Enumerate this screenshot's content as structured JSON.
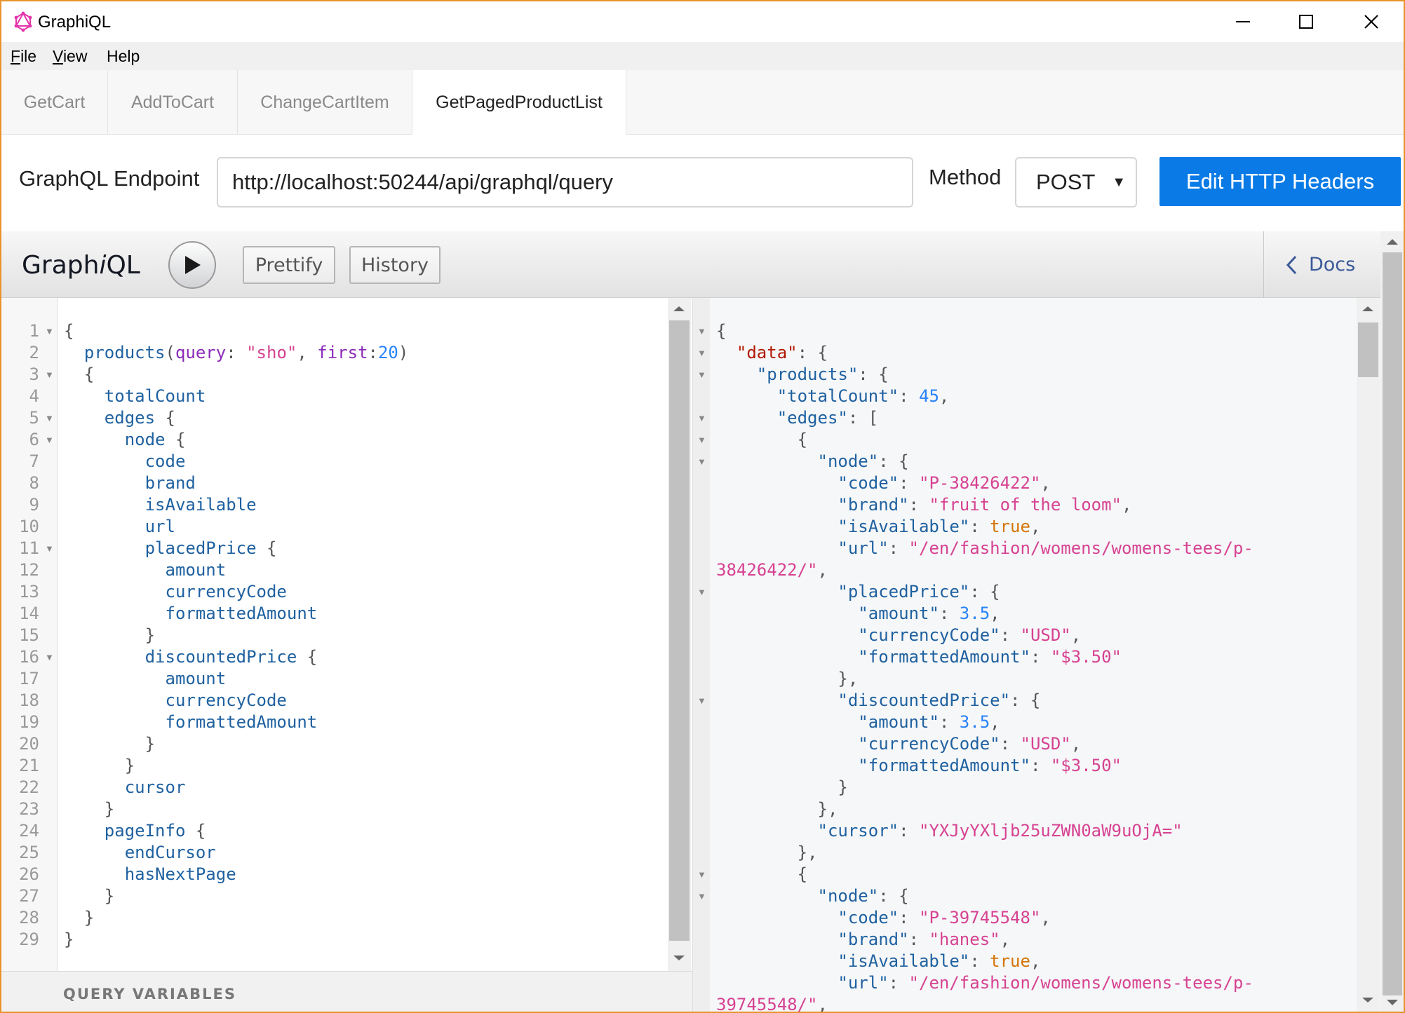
{
  "window": {
    "title": "GraphiQL",
    "accent_color": "#e8932b"
  },
  "menu": [
    {
      "label": "File",
      "mnemonic": "F",
      "rest": "ile"
    },
    {
      "label": "View",
      "mnemonic": "V",
      "rest": "iew"
    },
    {
      "label": "Help",
      "mnemonic": "",
      "rest": "Help"
    }
  ],
  "tabs": [
    {
      "label": "GetCart",
      "active": false
    },
    {
      "label": "AddToCart",
      "active": false
    },
    {
      "label": "ChangeCartItem",
      "active": false
    },
    {
      "label": "GetPagedProductList",
      "active": true
    }
  ],
  "endpoint": {
    "label": "GraphQL Endpoint",
    "value": "http://localhost:50244/api/graphql/query",
    "method_label": "Method",
    "method_value": "POST",
    "edit_headers_label": "Edit HTTP Headers",
    "button_color": "#0a7be6"
  },
  "graphiql": {
    "logo_pre": "Graph",
    "logo_i": "i",
    "logo_post": "QL",
    "prettify_label": "Prettify",
    "history_label": "History",
    "docs_label": "Docs",
    "query_variables_label": "QUERY VARIABLES"
  },
  "query_lines": [
    [
      [
        "p",
        "{"
      ]
    ],
    [
      [
        "d",
        "  products"
      ],
      [
        "p",
        "("
      ],
      [
        "a",
        "query"
      ],
      [
        "p",
        ": "
      ],
      [
        "s",
        "\"sho\""
      ],
      [
        "p",
        ", "
      ],
      [
        "a",
        "first"
      ],
      [
        "p",
        ":"
      ],
      [
        "n",
        "20"
      ],
      [
        "p",
        ")"
      ]
    ],
    [
      [
        "p",
        "  {"
      ]
    ],
    [
      [
        "d",
        "    totalCount"
      ]
    ],
    [
      [
        "d",
        "    edges"
      ],
      [
        "p",
        " {"
      ]
    ],
    [
      [
        "d",
        "      node"
      ],
      [
        "p",
        " {"
      ]
    ],
    [
      [
        "d",
        "        code"
      ]
    ],
    [
      [
        "d",
        "        brand"
      ]
    ],
    [
      [
        "d",
        "        isAvailable"
      ]
    ],
    [
      [
        "d",
        "        url"
      ]
    ],
    [
      [
        "d",
        "        placedPrice"
      ],
      [
        "p",
        " {"
      ]
    ],
    [
      [
        "d",
        "          amount"
      ]
    ],
    [
      [
        "d",
        "          currencyCode"
      ]
    ],
    [
      [
        "d",
        "          formattedAmount"
      ]
    ],
    [
      [
        "p",
        "        }"
      ]
    ],
    [
      [
        "d",
        "        discountedPrice"
      ],
      [
        "p",
        " {"
      ]
    ],
    [
      [
        "d",
        "          amount"
      ]
    ],
    [
      [
        "d",
        "          currencyCode"
      ]
    ],
    [
      [
        "d",
        "          formattedAmount"
      ]
    ],
    [
      [
        "p",
        "        }"
      ]
    ],
    [
      [
        "p",
        "      }"
      ]
    ],
    [
      [
        "d",
        "      cursor"
      ]
    ],
    [
      [
        "p",
        "    }"
      ]
    ],
    [
      [
        "d",
        "    pageInfo"
      ],
      [
        "p",
        " {"
      ]
    ],
    [
      [
        "d",
        "      endCursor"
      ]
    ],
    [
      [
        "d",
        "      hasNextPage"
      ]
    ],
    [
      [
        "p",
        "    }"
      ]
    ],
    [
      [
        "p",
        "  }"
      ]
    ],
    [
      [
        "p",
        "}"
      ]
    ]
  ],
  "query_fold_lines": [
    1,
    3,
    5,
    6,
    11,
    16
  ],
  "result_lines": [
    [
      [
        "p",
        "{"
      ]
    ],
    [
      [
        "p",
        "  "
      ],
      [
        "k",
        "\"data\""
      ],
      [
        "p",
        ": {"
      ]
    ],
    [
      [
        "p",
        "    "
      ],
      [
        "k2",
        "\"products\""
      ],
      [
        "p",
        ": {"
      ]
    ],
    [
      [
        "p",
        "      "
      ],
      [
        "k2",
        "\"totalCount\""
      ],
      [
        "p",
        ": "
      ],
      [
        "n",
        "45"
      ],
      [
        "p",
        ","
      ]
    ],
    [
      [
        "p",
        "      "
      ],
      [
        "k2",
        "\"edges\""
      ],
      [
        "p",
        ": ["
      ]
    ],
    [
      [
        "p",
        "        {"
      ]
    ],
    [
      [
        "p",
        "          "
      ],
      [
        "k2",
        "\"node\""
      ],
      [
        "p",
        ": {"
      ]
    ],
    [
      [
        "p",
        "            "
      ],
      [
        "k2",
        "\"code\""
      ],
      [
        "p",
        ": "
      ],
      [
        "s",
        "\"P-38426422\""
      ],
      [
        "p",
        ","
      ]
    ],
    [
      [
        "p",
        "            "
      ],
      [
        "k2",
        "\"brand\""
      ],
      [
        "p",
        ": "
      ],
      [
        "s",
        "\"fruit of the loom\""
      ],
      [
        "p",
        ","
      ]
    ],
    [
      [
        "p",
        "            "
      ],
      [
        "k2",
        "\"isAvailable\""
      ],
      [
        "p",
        ": "
      ],
      [
        "b",
        "true"
      ],
      [
        "p",
        ","
      ]
    ],
    [
      [
        "p",
        "            "
      ],
      [
        "k2",
        "\"url\""
      ],
      [
        "p",
        ": "
      ],
      [
        "s",
        "\"/en/fashion/womens/womens-tees/p-"
      ]
    ],
    [
      [
        "s",
        "38426422/\""
      ],
      [
        "p",
        ","
      ]
    ],
    [
      [
        "p",
        "            "
      ],
      [
        "k2",
        "\"placedPrice\""
      ],
      [
        "p",
        ": {"
      ]
    ],
    [
      [
        "p",
        "              "
      ],
      [
        "k2",
        "\"amount\""
      ],
      [
        "p",
        ": "
      ],
      [
        "n",
        "3.5"
      ],
      [
        "p",
        ","
      ]
    ],
    [
      [
        "p",
        "              "
      ],
      [
        "k2",
        "\"currencyCode\""
      ],
      [
        "p",
        ": "
      ],
      [
        "s",
        "\"USD\""
      ],
      [
        "p",
        ","
      ]
    ],
    [
      [
        "p",
        "              "
      ],
      [
        "k2",
        "\"formattedAmount\""
      ],
      [
        "p",
        ": "
      ],
      [
        "s",
        "\"$3.50\""
      ]
    ],
    [
      [
        "p",
        "            },"
      ]
    ],
    [
      [
        "p",
        "            "
      ],
      [
        "k2",
        "\"discountedPrice\""
      ],
      [
        "p",
        ": {"
      ]
    ],
    [
      [
        "p",
        "              "
      ],
      [
        "k2",
        "\"amount\""
      ],
      [
        "p",
        ": "
      ],
      [
        "n",
        "3.5"
      ],
      [
        "p",
        ","
      ]
    ],
    [
      [
        "p",
        "              "
      ],
      [
        "k2",
        "\"currencyCode\""
      ],
      [
        "p",
        ": "
      ],
      [
        "s",
        "\"USD\""
      ],
      [
        "p",
        ","
      ]
    ],
    [
      [
        "p",
        "              "
      ],
      [
        "k2",
        "\"formattedAmount\""
      ],
      [
        "p",
        ": "
      ],
      [
        "s",
        "\"$3.50\""
      ]
    ],
    [
      [
        "p",
        "            }"
      ]
    ],
    [
      [
        "p",
        "          },"
      ]
    ],
    [
      [
        "p",
        "          "
      ],
      [
        "k2",
        "\"cursor\""
      ],
      [
        "p",
        ": "
      ],
      [
        "s",
        "\"YXJyYXljb25uZWN0aW9uOjA=\""
      ]
    ],
    [
      [
        "p",
        "        },"
      ]
    ],
    [
      [
        "p",
        "        {"
      ]
    ],
    [
      [
        "p",
        "          "
      ],
      [
        "k2",
        "\"node\""
      ],
      [
        "p",
        ": {"
      ]
    ],
    [
      [
        "p",
        "            "
      ],
      [
        "k2",
        "\"code\""
      ],
      [
        "p",
        ": "
      ],
      [
        "s",
        "\"P-39745548\""
      ],
      [
        "p",
        ","
      ]
    ],
    [
      [
        "p",
        "            "
      ],
      [
        "k2",
        "\"brand\""
      ],
      [
        "p",
        ": "
      ],
      [
        "s",
        "\"hanes\""
      ],
      [
        "p",
        ","
      ]
    ],
    [
      [
        "p",
        "            "
      ],
      [
        "k2",
        "\"isAvailable\""
      ],
      [
        "p",
        ": "
      ],
      [
        "b",
        "true"
      ],
      [
        "p",
        ","
      ]
    ],
    [
      [
        "p",
        "            "
      ],
      [
        "k2",
        "\"url\""
      ],
      [
        "p",
        ": "
      ],
      [
        "s",
        "\"/en/fashion/womens/womens-tees/p-"
      ]
    ],
    [
      [
        "s",
        "39745548/\""
      ],
      [
        "p",
        ","
      ]
    ]
  ],
  "result_fold_lines": [
    1,
    2,
    3,
    5,
    6,
    7,
    13,
    18,
    26,
    27
  ]
}
